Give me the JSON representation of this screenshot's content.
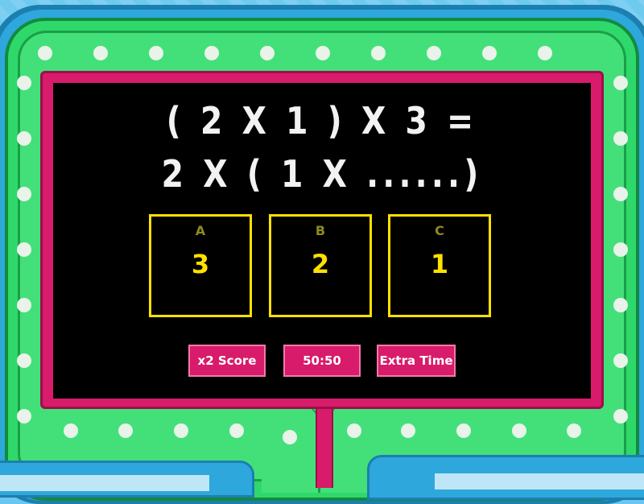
{
  "question": {
    "line1": "( 2 X 1 ) X 3 =",
    "line2": "2 X ( 1 X ......)"
  },
  "answers": [
    {
      "letter": "A",
      "value": "3"
    },
    {
      "letter": "B",
      "value": "2"
    },
    {
      "letter": "C",
      "value": "1"
    }
  ],
  "powerups": {
    "double_score": "x2 Score",
    "fifty_fifty": "50:50",
    "extra_time": "Extra Time"
  },
  "colors": {
    "board": "#000000",
    "frame_pink": "#d81b6a",
    "frame_green": "#2fd86a",
    "answer_border": "#ffe100"
  }
}
